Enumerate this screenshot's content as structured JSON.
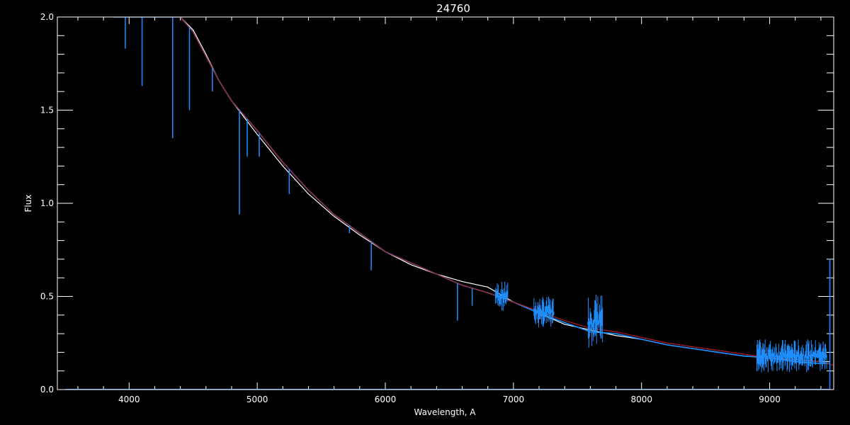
{
  "chart_data": {
    "type": "line",
    "title": "24760",
    "xlabel": "Wavelength, A",
    "ylabel": "Flux",
    "xlim": [
      3440,
      9500
    ],
    "ylim": [
      0,
      2
    ],
    "grid": false,
    "legend": "none",
    "x_ticks": [
      {
        "value": 4000,
        "label": "4000"
      },
      {
        "value": 5000,
        "label": "5000"
      },
      {
        "value": 6000,
        "label": "6000"
      },
      {
        "value": 7000,
        "label": "7000"
      },
      {
        "value": 8000,
        "label": "8000"
      },
      {
        "value": 9000,
        "label": "9000"
      }
    ],
    "y_ticks": [
      {
        "value": 0,
        "label": "0.0"
      },
      {
        "value": 0.5,
        "label": "0.5"
      },
      {
        "value": 1.0,
        "label": "1.0"
      },
      {
        "value": 1.5,
        "label": "1.5"
      },
      {
        "value": 2.0,
        "label": "2.0"
      }
    ],
    "series": [
      {
        "color": "#ffffff",
        "x": [
          4400,
          4500,
          4600,
          4700,
          4800,
          4900,
          5000,
          5200,
          5400,
          5600,
          5800,
          6000,
          6200,
          6400,
          6600,
          6800,
          7000,
          7200,
          7400,
          7600,
          7800,
          8000,
          8200,
          8400,
          8600,
          8800,
          9000,
          9200,
          9400,
          9470
        ],
        "y": [
          2.0,
          1.93,
          1.8,
          1.66,
          1.55,
          1.46,
          1.37,
          1.2,
          1.05,
          0.93,
          0.83,
          0.74,
          0.67,
          0.62,
          0.58,
          0.55,
          0.47,
          0.41,
          0.35,
          0.32,
          0.29,
          0.27,
          0.24,
          0.22,
          0.2,
          0.18,
          0.17,
          0.16,
          0.15,
          0.15
        ]
      },
      {
        "color": "#1e90ff",
        "x": [
          3880,
          3980,
          4100,
          4200,
          4300,
          4400,
          4500,
          4600,
          4700,
          4800,
          4900,
          5000,
          5200,
          5400,
          5600,
          5800,
          6000,
          6200,
          6400,
          6600,
          6800,
          7000,
          7200,
          7400,
          7600,
          7800,
          8000,
          8200,
          8400,
          8600,
          8800,
          9000,
          9200,
          9400,
          9470
        ],
        "y": [
          2.0,
          2.0,
          2.0,
          2.0,
          2.0,
          2.0,
          1.92,
          1.79,
          1.66,
          1.55,
          1.47,
          1.39,
          1.22,
          1.07,
          0.94,
          0.84,
          0.74,
          0.68,
          0.62,
          0.56,
          0.52,
          0.47,
          0.41,
          0.36,
          0.31,
          0.3,
          0.27,
          0.24,
          0.22,
          0.2,
          0.18,
          0.17,
          0.15,
          0.14,
          0.14
        ]
      },
      {
        "color": "#b01c2e",
        "x": [
          4330,
          4400,
          4500,
          4600,
          4700,
          4800,
          4900,
          5000,
          5200,
          5400,
          5600,
          5800,
          6000,
          6200,
          6400,
          6600,
          6800,
          7000,
          7200,
          7400,
          7600,
          7800,
          8000,
          8200,
          8400,
          8600,
          8800,
          9000,
          9200,
          9400,
          9500
        ],
        "y": [
          2.0,
          2.0,
          1.92,
          1.79,
          1.66,
          1.55,
          1.47,
          1.39,
          1.22,
          1.07,
          0.94,
          0.84,
          0.74,
          0.68,
          0.62,
          0.56,
          0.52,
          0.47,
          0.42,
          0.37,
          0.33,
          0.31,
          0.28,
          0.25,
          0.23,
          0.21,
          0.19,
          0.17,
          0.16,
          0.15,
          0.13
        ]
      }
    ],
    "absorption_lines": [
      {
        "x": 3970,
        "depth_to": 1.83
      },
      {
        "x": 4101,
        "depth_to": 1.63
      },
      {
        "x": 4340,
        "depth_to": 1.35
      },
      {
        "x": 4471,
        "depth_to": 1.5
      },
      {
        "x": 4650,
        "depth_to": 1.6
      },
      {
        "x": 4861,
        "depth_to": 0.94
      },
      {
        "x": 4922,
        "depth_to": 1.25
      },
      {
        "x": 5016,
        "depth_to": 1.25
      },
      {
        "x": 5250,
        "depth_to": 1.05
      },
      {
        "x": 5720,
        "depth_to": 0.84
      },
      {
        "x": 5890,
        "depth_to": 0.64
      },
      {
        "x": 6563,
        "depth_to": 0.37
      },
      {
        "x": 6678,
        "depth_to": 0.45
      }
    ],
    "noise_regions": [
      {
        "from": 6860,
        "to": 6960,
        "low": 0.42,
        "high": 0.58
      },
      {
        "from": 7160,
        "to": 7320,
        "low": 0.33,
        "high": 0.5
      },
      {
        "from": 7580,
        "to": 7700,
        "low": 0.2,
        "high": 0.52
      },
      {
        "from": 8900,
        "to": 9450,
        "low": 0.09,
        "high": 0.27
      }
    ]
  }
}
